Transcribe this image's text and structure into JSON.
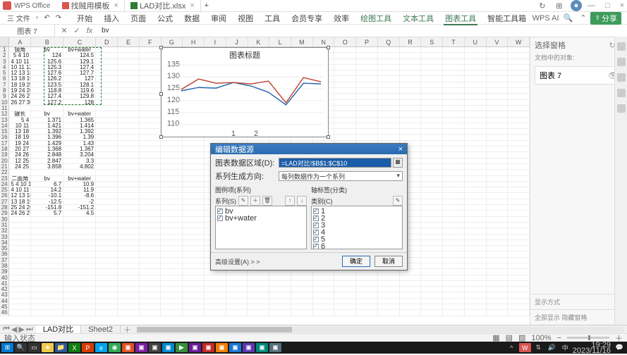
{
  "app": {
    "name": "WPS Office"
  },
  "doc_tabs": [
    {
      "label": "找贼用模板",
      "close": "×"
    },
    {
      "label": "LAD对比.xlsx",
      "close": "×"
    }
  ],
  "titlebar_plus": "+",
  "window_controls": {
    "min": "—",
    "max": "□",
    "close": "×"
  },
  "menubar": {
    "file": "三 文件",
    "tabs": [
      "开始",
      "插入",
      "页面",
      "公式",
      "数据",
      "审阅",
      "视图",
      "工具",
      "会员专享",
      "效率",
      "绘图工具",
      "文本工具",
      "图表工具",
      "智能工具箱"
    ],
    "active_tab_index": 12,
    "wps_ai": "WPS AI",
    "share": "分享"
  },
  "formula_bar": {
    "name_box": "图表 7",
    "formula": "bv"
  },
  "columns": [
    "A",
    "B",
    "C",
    "D",
    "E",
    "F",
    "G",
    "H",
    "I",
    "J",
    "K",
    "L",
    "M",
    "N",
    "O",
    "P",
    "Q",
    "R",
    "S",
    "T",
    "U",
    "V",
    "W"
  ],
  "row_count": 46,
  "block1": {
    "headers": [
      "镜角",
      "bv",
      "bv+water"
    ],
    "rows": [
      [
        "5 4 10",
        "124",
        "124.5"
      ],
      [
        "4 10 11",
        "125.6",
        "129.1"
      ],
      [
        "10 11 12",
        "125.3",
        "127.4"
      ],
      [
        "12 13 18",
        "127.6",
        "127.7"
      ],
      [
        "13 18 19",
        "126.2",
        "127"
      ],
      [
        "18 19 25",
        "123.5",
        "128.1"
      ],
      [
        "19 24 26",
        "118.8",
        "119.6"
      ],
      [
        "24 26 27",
        "127.4",
        "129.8"
      ],
      [
        "26 27 35",
        "127.2",
        "128"
      ]
    ]
  },
  "block2": {
    "headers": [
      "键长",
      "bv",
      "bv+water"
    ],
    "rows": [
      [
        "5 4",
        "1.371",
        "1.365"
      ],
      [
        "10 11",
        "1.421",
        "1.414"
      ],
      [
        "13 18",
        "1.392",
        "1.392"
      ],
      [
        "18 19",
        "1.396",
        "1.39"
      ],
      [
        "19 24",
        "1.429",
        "1.43"
      ],
      [
        "20 27",
        "1.368",
        "1.367"
      ],
      [
        "24 26",
        "2.848",
        "3.204"
      ],
      [
        "12 25",
        "2.847",
        "3.3"
      ],
      [
        "24 25",
        "3.858",
        "4.802"
      ]
    ]
  },
  "block3": {
    "headers": [
      "二面角",
      "bv",
      "bv+water"
    ],
    "rows": [
      [
        "5 4 10 11",
        "6.7",
        "10.9"
      ],
      [
        "4 10 11 12",
        "14.2",
        "11.9"
      ],
      [
        "12 13 18 19",
        "-10.1",
        "-8.6"
      ],
      [
        "13 18 19 25",
        "-12.5",
        "-2"
      ],
      [
        "25 24 26 27",
        "-151.8",
        "-151.2"
      ],
      [
        "24 26 27 35",
        "5.7",
        "4.5"
      ]
    ]
  },
  "chart": {
    "title": "图表标题",
    "y_ticks": [
      "135",
      "130",
      "125",
      "120",
      "115",
      "110"
    ],
    "x_ticks": [
      "1",
      "2"
    ]
  },
  "chart_data": {
    "type": "line",
    "title": "图表标题",
    "xlabel": "",
    "ylabel": "",
    "ylim": [
      110,
      135
    ],
    "categories": [
      "5 4 10",
      "4 10 11",
      "10 11 12",
      "12 13 18",
      "13 18 19",
      "18 19 25",
      "19 24 26",
      "24 26 27",
      "26 27 35"
    ],
    "series": [
      {
        "name": "bv",
        "values": [
          124,
          125.6,
          125.3,
          127.6,
          126.2,
          123.5,
          118.8,
          127.4,
          127.2
        ]
      },
      {
        "name": "bv+water",
        "values": [
          124.5,
          129.1,
          127.4,
          127.7,
          127,
          128.1,
          119.6,
          129.8,
          128
        ]
      }
    ]
  },
  "dialog": {
    "title": "编辑数据源",
    "range_label": "图表数据区域(D):",
    "range_value": "=LAD对比!$B$1:$C$10",
    "gen_label": "系列生成方向:",
    "gen_value": "每列数据作为一个系列",
    "series_header": "图例项(系列)",
    "axis_header": "轴标签(分类)",
    "series_sub": "系列(S)",
    "axis_sub": "类别(C)",
    "series_items": [
      "bv",
      "bv+water"
    ],
    "axis_items": [
      "1",
      "2",
      "3",
      "4",
      "5",
      "6"
    ],
    "advanced": "高级设置(A) > >",
    "ok": "确定",
    "cancel": "取消"
  },
  "side_panel": {
    "header": "选择窗格",
    "subtext": "文档中的对象:",
    "item": "图表 7",
    "footer": "显示方式"
  },
  "sheet_tabs": {
    "active": "LAD对比",
    "other": "Sheet2"
  },
  "status": {
    "left": "输入状态",
    "theme": "全部显示  隐藏窗格",
    "zoom": "100%"
  },
  "taskbar": {
    "time": "19:29",
    "date": "2023/11/16"
  }
}
